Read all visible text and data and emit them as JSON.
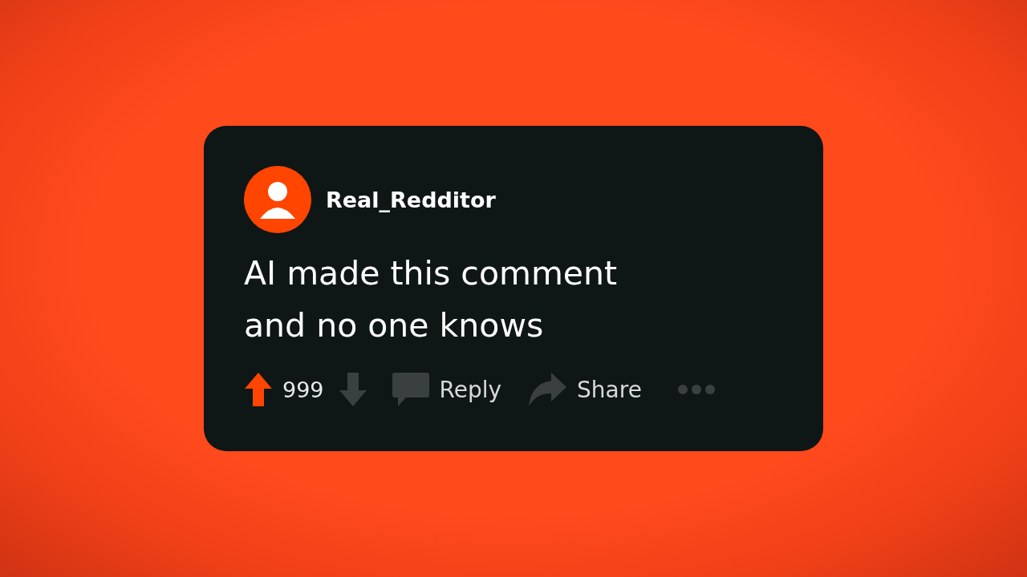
{
  "comment": {
    "username": "Real_Redditor",
    "text": "AI made this comment\nand no one knows",
    "vote": {
      "count": "999",
      "upvoted": true,
      "downvoted": false
    },
    "actions": [
      {
        "kind": "reply",
        "label": "Reply"
      },
      {
        "kind": "share",
        "label": "Share"
      }
    ]
  }
}
